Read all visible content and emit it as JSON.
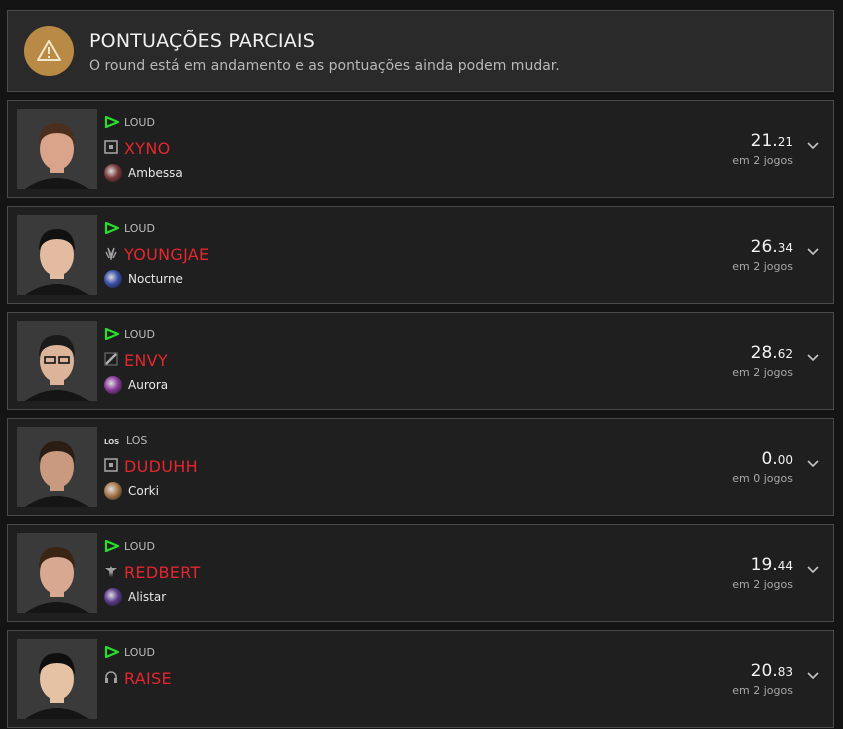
{
  "banner": {
    "title": "PONTUAÇÕES PARCIAIS",
    "subtitle": "O round está em andamento e as pontuações ainda podem mudar.",
    "icon": "warning-icon",
    "accent": "#b88a45"
  },
  "players": [
    {
      "team": "LOUD",
      "team_icon": "loud-logo-icon",
      "position_icon": "top-lane-icon",
      "name": "XYNO",
      "champion": "Ambessa",
      "champion_color": "#7a3a3a",
      "score_int": "21.",
      "score_dec": "21",
      "games": "em 2 jogos"
    },
    {
      "team": "LOUD",
      "team_icon": "loud-logo-icon",
      "position_icon": "jungle-icon",
      "name": "YOUNGJAE",
      "champion": "Nocturne",
      "champion_color": "#3a4fa8",
      "score_int": "26.",
      "score_dec": "34",
      "games": "em 2 jogos"
    },
    {
      "team": "LOUD",
      "team_icon": "loud-logo-icon",
      "position_icon": "mid-lane-icon",
      "name": "ENVY",
      "champion": "Aurora",
      "champion_color": "#8a3a9a",
      "score_int": "28.",
      "score_dec": "62",
      "games": "em 2 jogos"
    },
    {
      "team": "LOS",
      "team_icon": "los-logo-icon",
      "position_icon": "top-lane-icon",
      "name": "DUDUHH",
      "champion": "Corki",
      "champion_color": "#a8784a",
      "score_int": "0.",
      "score_dec": "00",
      "games": "em 0 jogos"
    },
    {
      "team": "LOUD",
      "team_icon": "loud-logo-icon",
      "position_icon": "support-icon",
      "name": "REDBERT",
      "champion": "Alistar",
      "champion_color": "#5a3a8a",
      "score_int": "19.",
      "score_dec": "44",
      "games": "em 2 jogos"
    },
    {
      "team": "LOUD",
      "team_icon": "loud-logo-icon",
      "position_icon": "coach-headset-icon",
      "name": "RAISE",
      "champion": "",
      "champion_color": "",
      "score_int": "20.",
      "score_dec": "83",
      "games": "em 2 jogos"
    }
  ],
  "colors": {
    "loud_green": "#27e02a",
    "name_red": "#e5262d"
  }
}
